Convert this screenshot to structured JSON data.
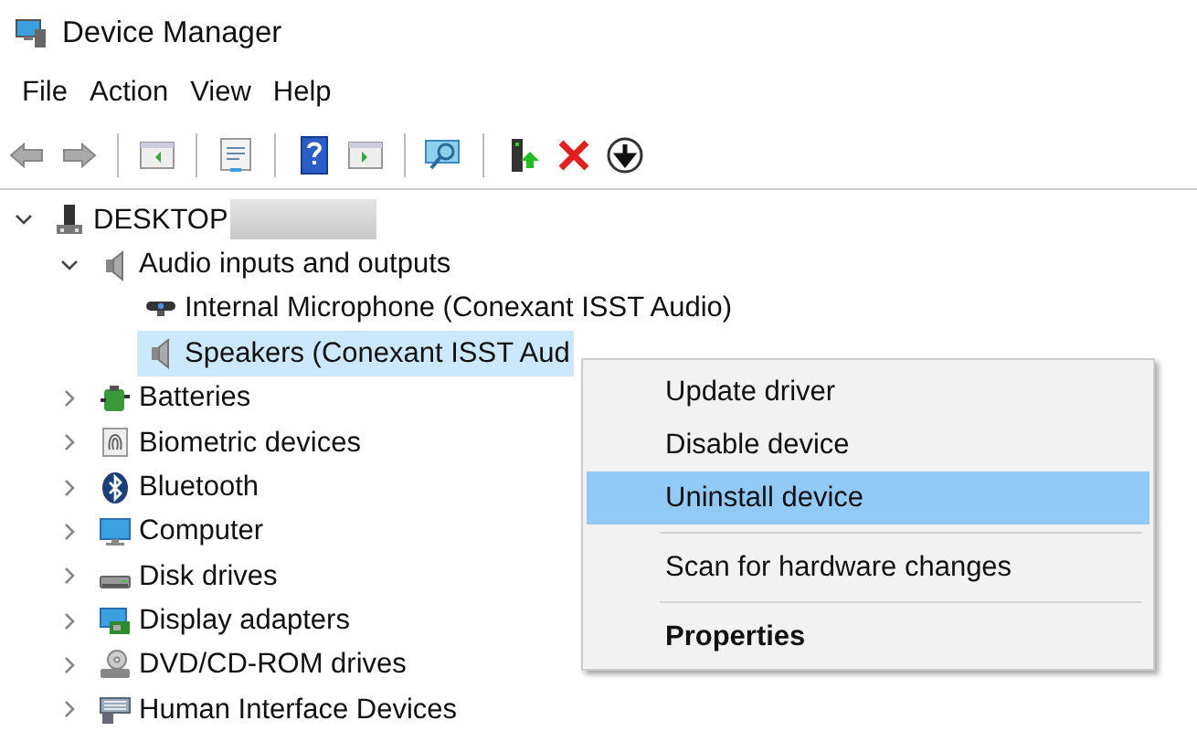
{
  "window": {
    "title": "Device Manager"
  },
  "menu_bar": [
    "File",
    "Action",
    "View",
    "Help"
  ],
  "tree": [
    {
      "label": "DESKTOP",
      "kind": "computer",
      "expanded": true,
      "selected": false,
      "redacted": true,
      "children": [
        {
          "label": "Audio inputs and outputs",
          "kind": "speaker",
          "expanded": true,
          "selected": false,
          "children": [
            {
              "label": "Internal Microphone (Conexant ISST Audio)",
              "kind": "microphone",
              "selected": false
            },
            {
              "label": "Speakers (Conexant ISST Aud",
              "kind": "speaker",
              "selected": true
            }
          ]
        },
        {
          "label": "Batteries",
          "kind": "battery",
          "expanded": false,
          "selected": false
        },
        {
          "label": "Biometric devices",
          "kind": "fingerprint",
          "expanded": false,
          "selected": false
        },
        {
          "label": "Bluetooth",
          "kind": "bluetooth",
          "expanded": false,
          "selected": false
        },
        {
          "label": "Computer",
          "kind": "monitor",
          "expanded": false,
          "selected": false
        },
        {
          "label": "Disk drives",
          "kind": "disk",
          "expanded": false,
          "selected": false
        },
        {
          "label": "Display adapters",
          "kind": "adapter",
          "expanded": false,
          "selected": false
        },
        {
          "label": "DVD/CD-ROM drives",
          "kind": "optical",
          "expanded": false,
          "selected": false
        },
        {
          "label": "Human Interface Devices",
          "kind": "keyboard",
          "expanded": false,
          "selected": false
        }
      ]
    }
  ],
  "context_menu": {
    "groups": [
      [
        {
          "label": "Update driver",
          "selected": false,
          "default": false
        },
        {
          "label": "Disable device",
          "selected": false,
          "default": false
        },
        {
          "label": "Uninstall device",
          "selected": true,
          "default": false
        }
      ],
      [
        {
          "label": "Scan for hardware changes",
          "selected": false,
          "default": false
        }
      ],
      [
        {
          "label": "Properties",
          "selected": false,
          "default": true
        }
      ]
    ]
  }
}
